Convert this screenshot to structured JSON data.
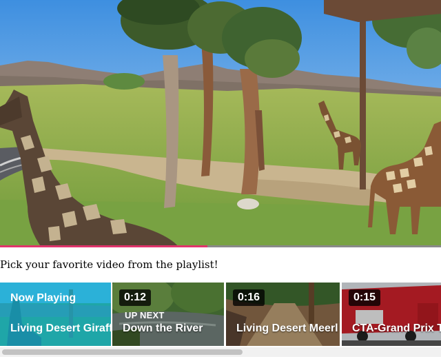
{
  "player": {
    "progress_percent": 47
  },
  "prompt": "Pick your favorite video from the playlist!",
  "playlist": [
    {
      "status": "Now Playing",
      "duration": "",
      "label": "",
      "title": "Living Desert Giraff"
    },
    {
      "status": "",
      "duration": "0:12",
      "label": "UP NEXT",
      "title": "Down the River"
    },
    {
      "status": "",
      "duration": "0:16",
      "label": "",
      "title": "Living Desert Meerl"
    },
    {
      "status": "",
      "duration": "0:15",
      "label": "",
      "title": "CTA-Grand Prix T"
    }
  ],
  "colors": {
    "progress": "#e0346c",
    "now_playing_overlay": "#00aad2"
  },
  "scroll": {
    "position_fraction": 0.0,
    "visible_fraction": 0.55
  }
}
